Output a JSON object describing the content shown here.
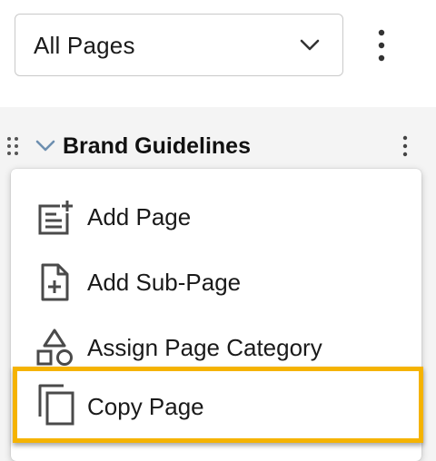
{
  "page_filter": {
    "selected": "All Pages"
  },
  "tree": {
    "page_title": "Brand Guidelines"
  },
  "context_menu": {
    "items": [
      {
        "label": "Add Page",
        "icon": "add-page-icon"
      },
      {
        "label": "Add Sub-Page",
        "icon": "add-sub-page-icon"
      },
      {
        "label": "Assign Page Category",
        "icon": "category-shapes-icon"
      },
      {
        "label": "Copy Page",
        "icon": "copy-icon"
      }
    ]
  },
  "colors": {
    "highlight": "#f5b301",
    "icon": "#4a4a4a",
    "tree_background": "#f4f4f4"
  }
}
